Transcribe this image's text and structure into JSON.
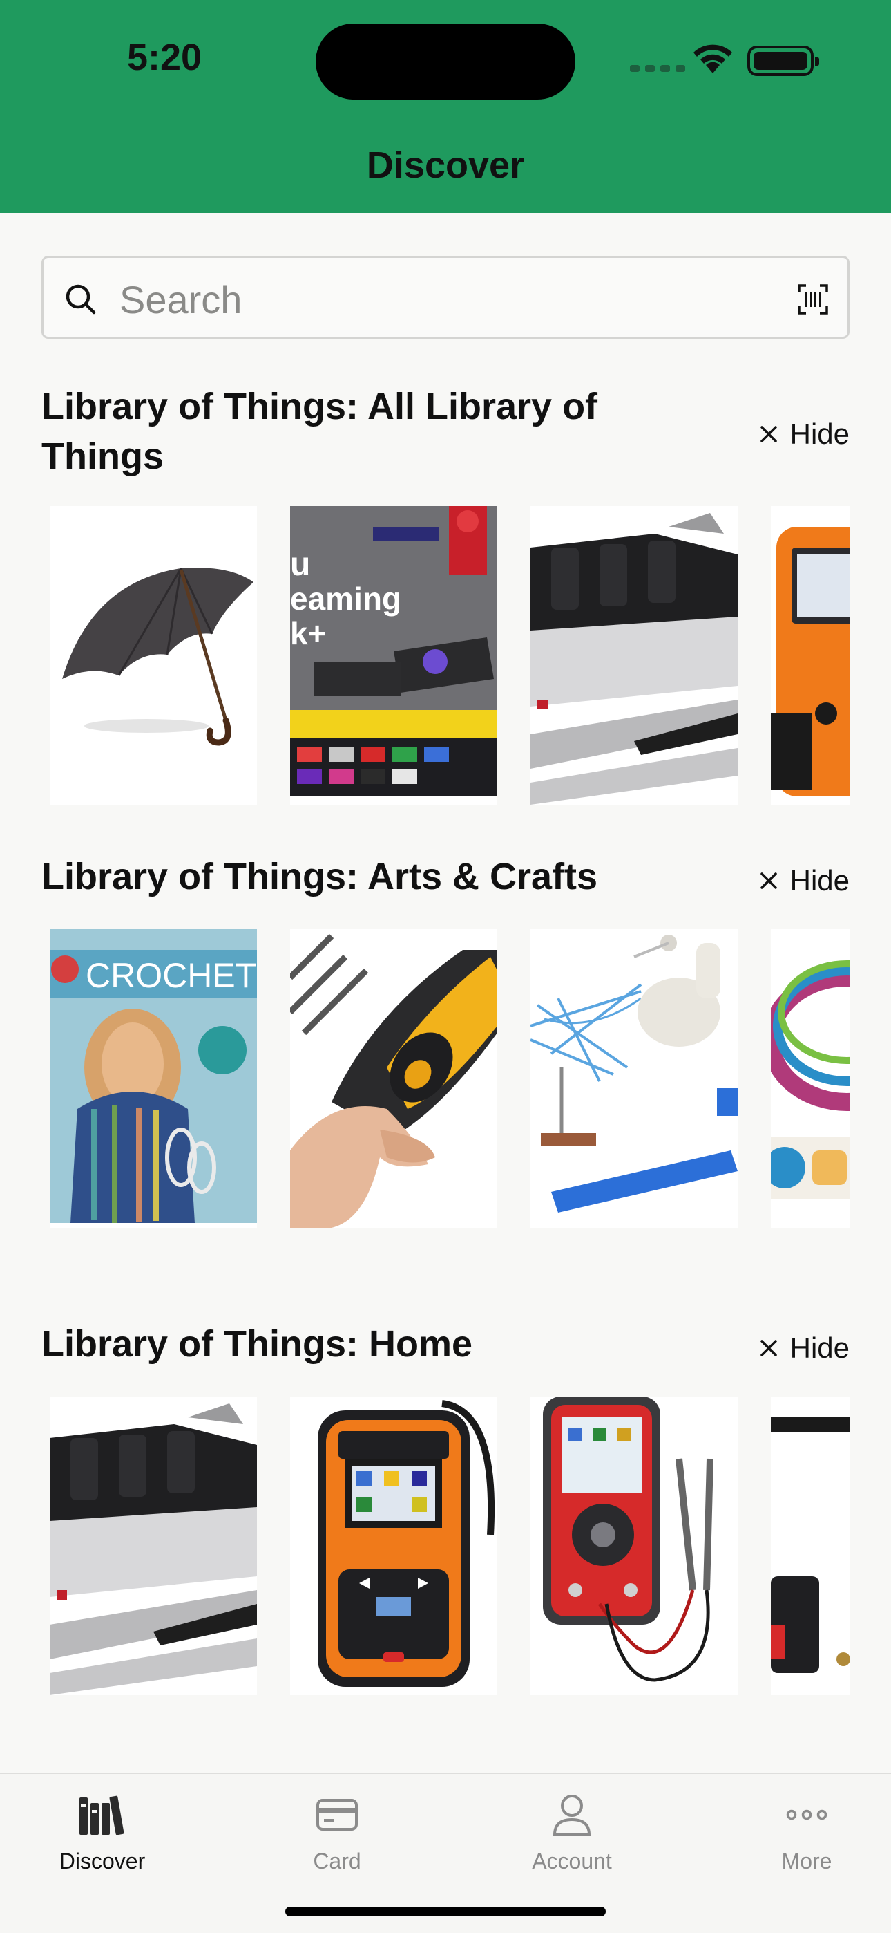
{
  "status": {
    "time": "5:20"
  },
  "header": {
    "title": "Discover"
  },
  "search": {
    "placeholder": "Search"
  },
  "sections": [
    {
      "title": "Library of Things: All Library of Things",
      "hide_label": "Hide",
      "items": [
        "umbrella",
        "streaming-stick-box",
        "knife-sharpener",
        "obd-scanner"
      ]
    },
    {
      "title": "Library of Things: Arts & Crafts",
      "hide_label": "Hide",
      "items": [
        "crochet-book",
        "hot-glue-gun",
        "yarn-swift-winder",
        "knitting-loom"
      ]
    },
    {
      "title": "Library of Things: Home",
      "hide_label": "Hide",
      "items": [
        "knife-sharpener",
        "obd-scanner",
        "multimeter",
        "power-tool-battery"
      ]
    }
  ],
  "crochet_cover_text": "CROCHET",
  "tabs": [
    {
      "label": "Discover",
      "icon": "books-icon",
      "active": true
    },
    {
      "label": "Card",
      "icon": "card-icon",
      "active": false
    },
    {
      "label": "Account",
      "icon": "person-icon",
      "active": false
    },
    {
      "label": "More",
      "icon": "ellipsis-icon",
      "active": false
    }
  ],
  "colors": {
    "header": "#1f9a5e",
    "background": "#f8f8f6",
    "tab_active": "#111111",
    "tab_inactive": "#8b8b8b"
  }
}
